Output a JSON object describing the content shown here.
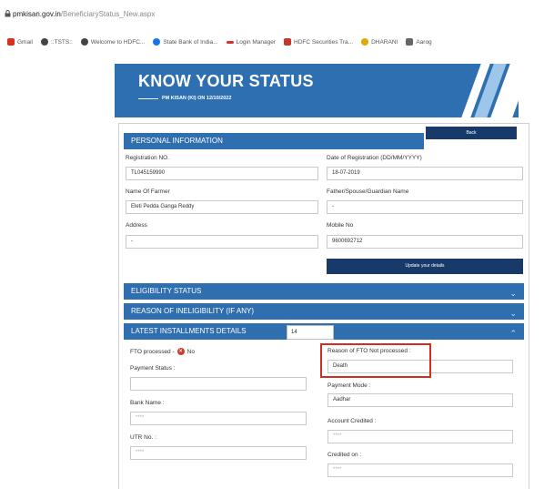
{
  "browser": {
    "url_host": "pmkisan.gov.in",
    "url_path": "/BeneficiaryStatus_New.aspx",
    "bookmarks": [
      {
        "label": "Gmail",
        "icon": "gmail-icon",
        "color": "#d93025"
      },
      {
        "label": "::TSTS::",
        "icon": "globe-icon",
        "color": "#444444"
      },
      {
        "label": "Welcome to HDFC...",
        "icon": "globe-icon",
        "color": "#444444"
      },
      {
        "label": "State Bank of India...",
        "icon": "sbi-icon",
        "color": "#1a73e8"
      },
      {
        "label": "Login Manager",
        "icon": "login-manager-icon",
        "color": "#d93025"
      },
      {
        "label": "HDFC Securities Tra...",
        "icon": "hdfc-icon",
        "color": "#c0392b"
      },
      {
        "label": "DHARANI",
        "icon": "dharani-icon",
        "color": "#e0a800"
      },
      {
        "label": "Aarog",
        "icon": "aarogya-icon",
        "color": "#666666"
      }
    ]
  },
  "banner": {
    "title": "KNOW YOUR STATUS",
    "subtitle": "PM KISAN (KI) ON 12/10/2022"
  },
  "buttons": {
    "back": "Back",
    "update_details": "Update your details"
  },
  "personal": {
    "header": "PERSONAL INFORMATION",
    "registration_no_label": "Registration NO.",
    "registration_no": "TL045159990",
    "registration_date_label": "Date of Registration (DD/MM/YYYY)",
    "registration_date": "18-07-2019",
    "farmer_name_label": "Name Of Farmer",
    "farmer_name": "Eleti Pedda Ganga Reddy",
    "father_name_label": "Father/Spouse/Guardian Name",
    "father_name": "-",
    "address_label": "Address",
    "address": "-",
    "mobile_label": "Mobile No",
    "mobile": "9600692712"
  },
  "sections": {
    "eligibility": "ELIGIBILITY STATUS",
    "ineligibility": "REASON OF INELIGIBILITY (IF ANY)",
    "installments": "LATEST INSTALLMENTS DETAILS",
    "installment_number": "14"
  },
  "installments": {
    "ftd_processed_label": "FTO processed -",
    "ftd_processed_value": "No",
    "payment_status_label": "Payment Status :",
    "payment_status": "",
    "reason_label": "Reason of FTO Not processed :",
    "reason": "Death",
    "payment_mode_label": "Payment Mode :",
    "payment_mode": "Aadhar",
    "bank_name_label": "Bank Name :",
    "bank_name": "****",
    "account_credited_label": "Account Credited :",
    "account_credited": "****",
    "utr_label": "UTR No. :",
    "utr": "****",
    "credited_on_label": "Credited on :",
    "credited_on": "****"
  },
  "colors": {
    "header_blue": "#2f6eaf",
    "button_navy": "#173a6a",
    "highlight_red": "#d62d20"
  }
}
